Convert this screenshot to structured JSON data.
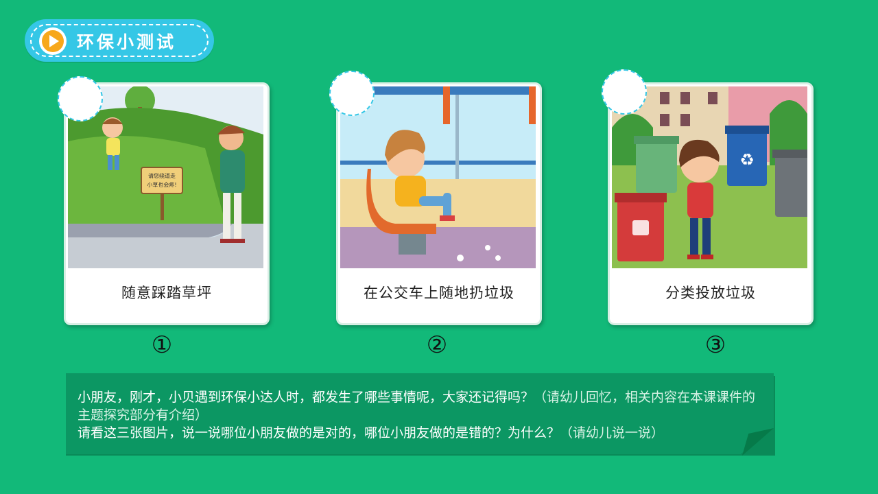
{
  "header": {
    "title": "环保小测试"
  },
  "cards": [
    {
      "label": "随意踩踏草坪",
      "number": "①",
      "sign": [
        "请您绕道走",
        "小草也会疼!"
      ]
    },
    {
      "label": "在公交车上随地扔垃圾",
      "number": "②"
    },
    {
      "label": "分类投放垃圾",
      "number": "③"
    }
  ],
  "note": {
    "line1": "小朋友，刚才，小贝遇到环保小达人时，都发生了哪些事情呢，大家还记得吗？",
    "hint1": "（请幼儿回忆，相关内容在本课课件的主题探究部分有介绍）",
    "line2": "请看这三张图片，说一说哪位小朋友做的是对的，哪位小朋友做的是错的？为什么？",
    "hint2": "（请幼儿说一说）"
  },
  "colors": {
    "background": "#12b979",
    "pill": "#35c7e6",
    "note": "#0c9763",
    "play": "#f7a81b"
  }
}
